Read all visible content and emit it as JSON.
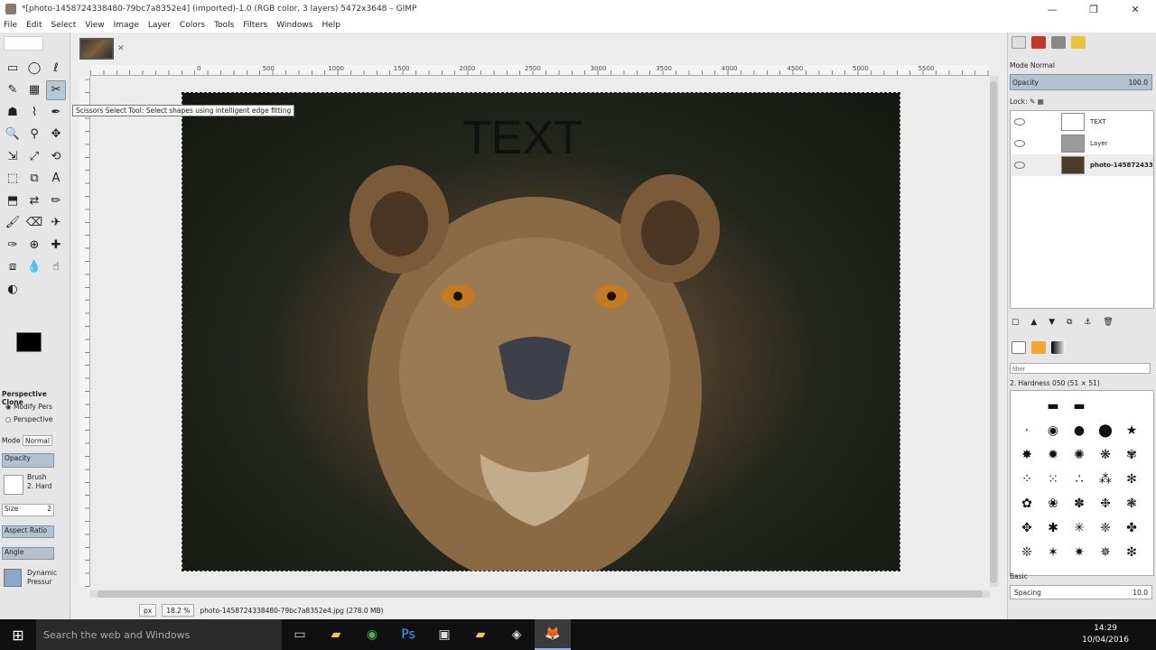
{
  "window": {
    "title": "*[photo-1458724338480-79bc7a8352e4] (imported)-1.0 (RGB color, 3 layers) 5472x3648 – GIMP",
    "minimize": "—",
    "maximize": "❐",
    "close": "✕"
  },
  "menu": [
    "File",
    "Edit",
    "Select",
    "View",
    "Image",
    "Layer",
    "Colors",
    "Tools",
    "Filters",
    "Windows",
    "Help"
  ],
  "tooltip": "Scissors Select Tool: Select shapes using intelligent edge fitting",
  "toolbox": {
    "tools": [
      {
        "icon": "▭",
        "name": "rect-select-icon"
      },
      {
        "icon": "◯",
        "name": "ellipse-select-icon"
      },
      {
        "icon": "ℓ",
        "name": "free-select-icon"
      },
      {
        "icon": "✎",
        "name": "fuzzy-select-icon"
      },
      {
        "icon": "▦",
        "name": "color-select-icon"
      },
      {
        "icon": "✂",
        "name": "scissors-select-icon"
      },
      {
        "icon": "☗",
        "name": "foreground-select-icon"
      },
      {
        "icon": "⌇",
        "name": "paths-icon"
      },
      {
        "icon": "✒",
        "name": "color-picker-icon"
      },
      {
        "icon": "🔍",
        "name": "zoom-icon"
      },
      {
        "icon": "⚲",
        "name": "measure-icon"
      },
      {
        "icon": "✥",
        "name": "move-icon"
      },
      {
        "icon": "⇲",
        "name": "align-icon"
      },
      {
        "icon": "⤢",
        "name": "crop-icon"
      },
      {
        "icon": "⟲",
        "name": "rotate-icon"
      },
      {
        "icon": "⬚",
        "name": "scale-icon"
      },
      {
        "icon": "⧉",
        "name": "shear-icon"
      },
      {
        "icon": "A",
        "name": "text-icon"
      },
      {
        "icon": "⬒",
        "name": "perspective-icon"
      },
      {
        "icon": "⇄",
        "name": "flip-icon"
      },
      {
        "icon": "✏",
        "name": "pencil-icon"
      },
      {
        "icon": "🖌",
        "name": "paintbrush-icon"
      },
      {
        "icon": "⌫",
        "name": "eraser-icon"
      },
      {
        "icon": "✈",
        "name": "airbrush-icon"
      },
      {
        "icon": "✑",
        "name": "ink-icon"
      },
      {
        "icon": "⊕",
        "name": "heal-icon"
      },
      {
        "icon": "✚",
        "name": "clone-icon"
      },
      {
        "icon": "⧈",
        "name": "perspective-clone-icon"
      },
      {
        "icon": "💧",
        "name": "blur-icon"
      },
      {
        "icon": "☝",
        "name": "smudge-icon"
      },
      {
        "icon": "◐",
        "name": "dodge-burn-icon"
      }
    ],
    "options_title": "Perspective Clone",
    "modify_label": "Modify Pers",
    "perspective_label": "Perspective",
    "mode_label": "Mode",
    "mode_value": "Normal",
    "opacity_label": "Opacity",
    "brush_label": "Brush",
    "brush_value": "2. Hard",
    "size_label": "Size",
    "size_value": "2",
    "aspect_label": "Aspect Ratio",
    "angle_label": "Angle",
    "dynamics_label": "Dynamic",
    "dynamics_value": "Pressur"
  },
  "canvas": {
    "text_layer": "TEXT",
    "ruler_labels": [
      "0",
      "500",
      "1000",
      "1500",
      "2000",
      "2500",
      "3000",
      "3500",
      "4000",
      "4500",
      "5000",
      "5500"
    ],
    "unit": "px",
    "zoom": "18.2 %",
    "status": "photo-1458724338480-79bc7a8352e4.jpg (278.0 MB)"
  },
  "dock": {
    "mode_label": "Mode",
    "mode_value": "Normal",
    "opacity_label": "Opacity",
    "opacity_value": "100.0",
    "lock_label": "Lock:",
    "layers": [
      {
        "name": "TEXT",
        "color": "#ffffff"
      },
      {
        "name": "Layer",
        "color": "#9a9a9a"
      },
      {
        "name": "photo-145872433",
        "color": "#4a3e2a"
      }
    ],
    "filter_placeholder": "filter",
    "brush_title": "2. Hardness 050 (51 × 51)",
    "brush_category": "Basic",
    "spacing_label": "Spacing",
    "spacing_value": "10.0"
  },
  "taskbar": {
    "search_text": "Search the web and Windows",
    "time": "14:29",
    "date": "10/04/2016"
  }
}
